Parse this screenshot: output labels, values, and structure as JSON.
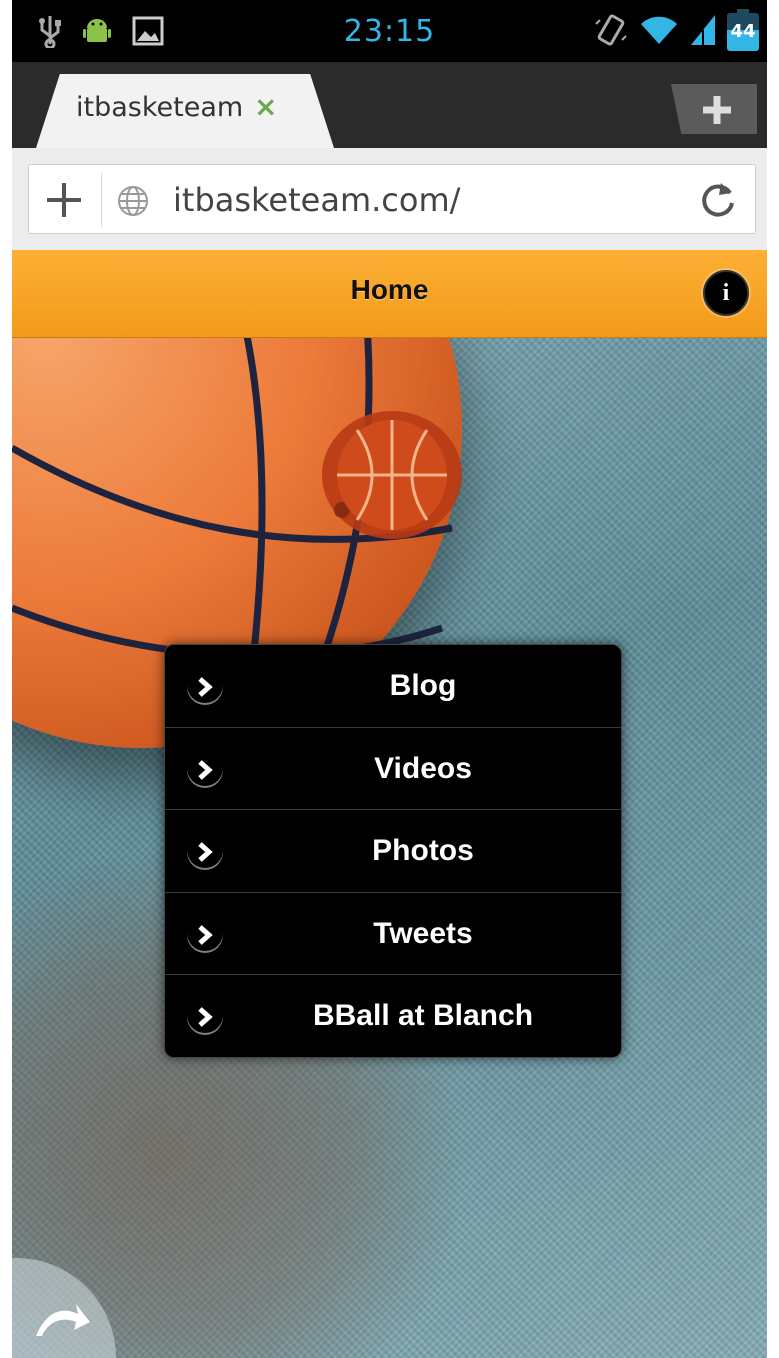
{
  "status_bar": {
    "time": "23:15",
    "battery": "44",
    "icons": [
      "usb-icon",
      "android-debug-icon",
      "image-icon",
      "vibrate-icon",
      "wifi-icon",
      "signal-icon",
      "battery-icon"
    ]
  },
  "browser": {
    "tab_title": "itbasketeam",
    "tab_close": "×",
    "url": "itbasketeam.com/"
  },
  "header": {
    "title": "Home",
    "info_icon_label": "i"
  },
  "menu": {
    "items": [
      {
        "label": "Blog"
      },
      {
        "label": "Videos"
      },
      {
        "label": "Photos"
      },
      {
        "label": "Tweets"
      },
      {
        "label": "BBall at Blanch"
      }
    ]
  },
  "colors": {
    "accent_orange": "#f7a226",
    "status_blue": "#33b5e5",
    "menu_bg": "#000000"
  }
}
